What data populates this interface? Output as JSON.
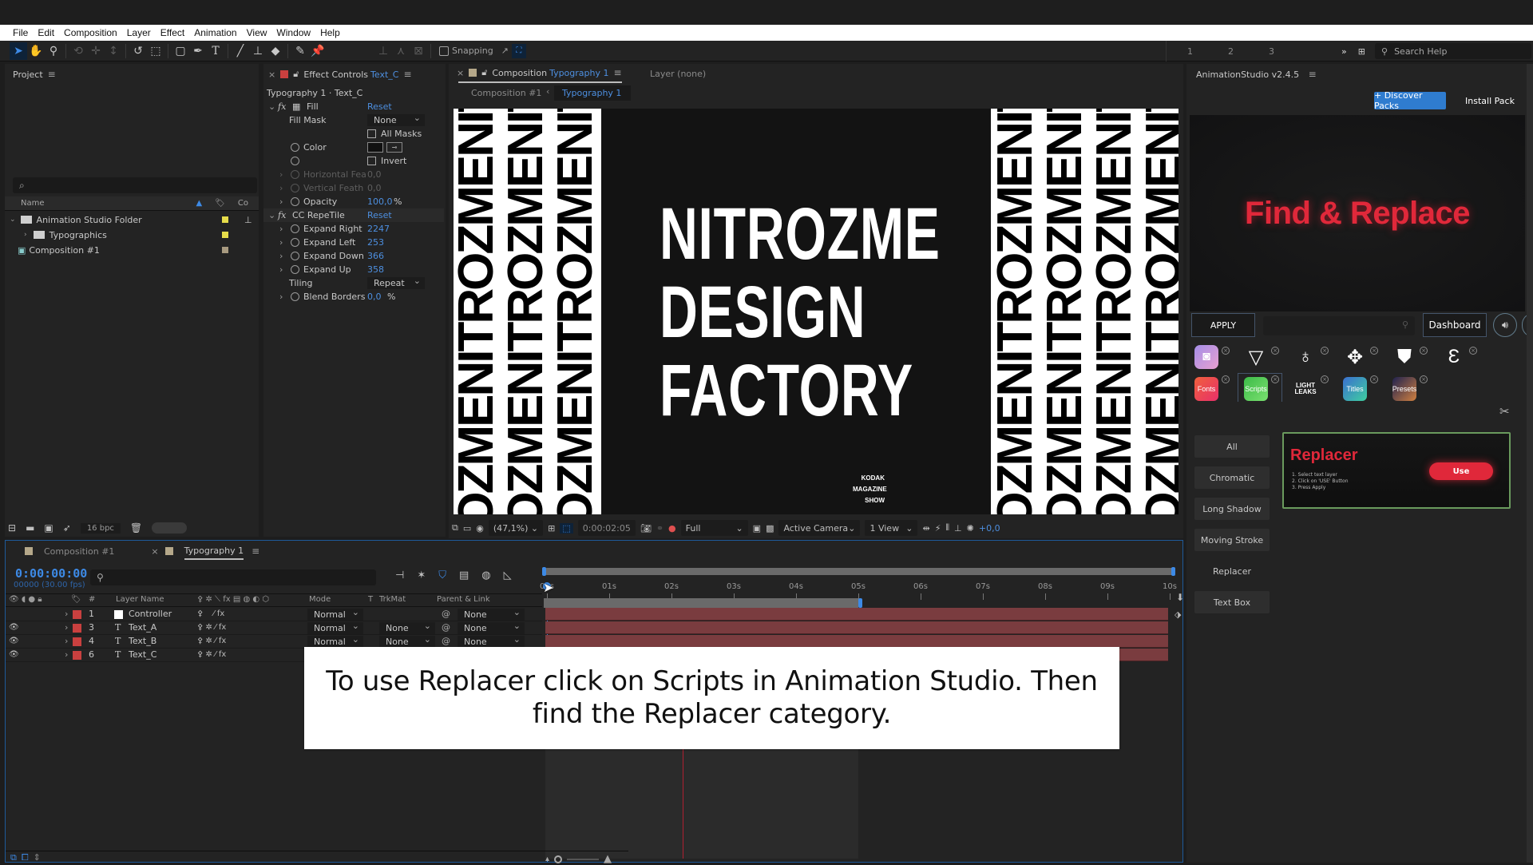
{
  "menu": [
    "File",
    "Edit",
    "Composition",
    "Layer",
    "Effect",
    "Animation",
    "View",
    "Window",
    "Help"
  ],
  "toolbar": {
    "snapping_label": "Snapping",
    "workspaces": [
      "1",
      "2",
      "3"
    ],
    "overflow": "»",
    "search_help_placeholder": "Search Help"
  },
  "project": {
    "title": "Project",
    "search_icon": "⌕",
    "columns": {
      "name": "Name",
      "comment": "Co"
    },
    "items": [
      {
        "name": "Animation Studio Folder",
        "type": "folder",
        "expanded": true,
        "label_color": "#e6dc4a"
      },
      {
        "name": "Typographics",
        "type": "folder",
        "expanded": false,
        "label_color": "#e6dc4a"
      },
      {
        "name": "Composition #1",
        "type": "composition",
        "label_color": "#a89a80"
      }
    ],
    "bpc": "16 bpc"
  },
  "effect_controls": {
    "tab_prefix": "Effect Controls",
    "tab_layer": "Text_C",
    "breadcrumb": "Typography 1 · Text_C",
    "effects": [
      {
        "name": "Fill",
        "reset": "Reset"
      },
      {
        "name": "CC RepeTile",
        "reset": "Reset"
      }
    ],
    "fill_props": {
      "fill_mask_label": "Fill Mask",
      "fill_mask_value": "None",
      "all_masks_label": "All Masks",
      "color_label": "Color",
      "invert_label": "Invert",
      "h_feather_label": "Horizontal Fea",
      "h_feather_value": "0,0",
      "v_feather_label": "Vertical Feath",
      "v_feather_value": "0,0",
      "opacity_label": "Opacity",
      "opacity_value": "100,0",
      "opacity_unit": "%"
    },
    "repetile_props": {
      "expand_right_label": "Expand Right",
      "expand_right": "2247",
      "expand_left_label": "Expand Left",
      "expand_left": "253",
      "expand_down_label": "Expand Down",
      "expand_down": "366",
      "expand_up_label": "Expand Up",
      "expand_up": "358",
      "tiling_label": "Tiling",
      "tiling_value": "Repeat",
      "blend_label": "Blend Borders",
      "blend_value": "0,0",
      "blend_unit": "%"
    }
  },
  "composition": {
    "tab_prefix": "Composition",
    "tab_name": "Typography 1",
    "layer_tab": "Layer (none)",
    "crumbs": [
      "Composition #1",
      "Typography 1"
    ],
    "canvas": {
      "title_lines": [
        "NITROZME",
        "DESIGN",
        "FACTORY"
      ],
      "strip_text": "NITROZMENITROZMENITROZ",
      "kodak_lines": [
        "KODAK",
        "MAGAZINE",
        "SHOW"
      ]
    },
    "viewer_bar": {
      "zoom": "(47,1%)",
      "time": "0:00:02:05",
      "resolution": "Full",
      "camera": "Active Camera",
      "views": "1 View",
      "exposure": "+0,0"
    }
  },
  "timeline": {
    "tabs": [
      {
        "label": "Composition #1",
        "active": false
      },
      {
        "label": "Typography 1",
        "active": true
      }
    ],
    "timecode": "0:00:00:00",
    "frames": "00000 (30.00 fps)",
    "columns": {
      "layer_name": "Layer Name",
      "mode": "Mode",
      "t": "T",
      "trkmat": "TrkMat",
      "parent": "Parent & Link",
      "num": "#"
    },
    "layers": [
      {
        "num": "1",
        "type": "solid",
        "name": "Controller",
        "mode": "Normal",
        "trkmat": "",
        "parent": "None",
        "visible": false
      },
      {
        "num": "3",
        "type": "text",
        "name": "Text_A",
        "mode": "Normal",
        "trkmat": "None",
        "parent": "None",
        "visible": true
      },
      {
        "num": "4",
        "type": "text",
        "name": "Text_B",
        "mode": "Normal",
        "trkmat": "None",
        "parent": "None",
        "visible": true
      },
      {
        "num": "6",
        "type": "text",
        "name": "Text_C",
        "mode": "Normal",
        "trkmat": "None",
        "parent": "None",
        "visible": true
      }
    ],
    "ruler_ticks": [
      "00s",
      "01s",
      "02s",
      "03s",
      "04s",
      "05s",
      "06s",
      "07s",
      "08s",
      "09s",
      "10s"
    ],
    "work_area_end_seconds": 5,
    "playhead_seconds": 0
  },
  "caption": "To use Replacer click on Scripts in Animation Studio. Then find the Replacer category.",
  "animation_studio": {
    "title": "AnimationStudio v2.4.5",
    "discover_label": "+ Discover Packs",
    "install_label": "Install Pack",
    "banner_text": "Find & Replace",
    "apply_label": "APPLY",
    "dashboard_label": "Dashboard",
    "packs_row1": [
      "instagram-pack",
      "v-pack",
      "o-pack",
      "diamond-pack",
      "shield-pack",
      "e-pack"
    ],
    "packs_row2": [
      {
        "label": "Fonts",
        "color": "#f0603c",
        "selected": false
      },
      {
        "label": "Scripts",
        "color": "#3dbb48",
        "selected": true
      },
      {
        "label": "LIGHT LEAKS",
        "color": "#232323",
        "selected": false
      },
      {
        "label": "Titles",
        "color": "#3b6fd0",
        "selected": false
      },
      {
        "label": "Presets",
        "color": "#1f2250",
        "selected": false
      }
    ],
    "categories": [
      "All",
      "Chromatic",
      "Long Shadow",
      "Moving Stroke",
      "Replacer",
      "Text Box"
    ],
    "selected_category": "Replacer",
    "card": {
      "title": "Replacer",
      "steps": [
        "1. Select text layer",
        "2. Click on 'USE' Button",
        "3. Press Apply"
      ],
      "use_label": "Use"
    },
    "accent_red": "#e0283a",
    "accent_blue": "#2f7ccf"
  }
}
